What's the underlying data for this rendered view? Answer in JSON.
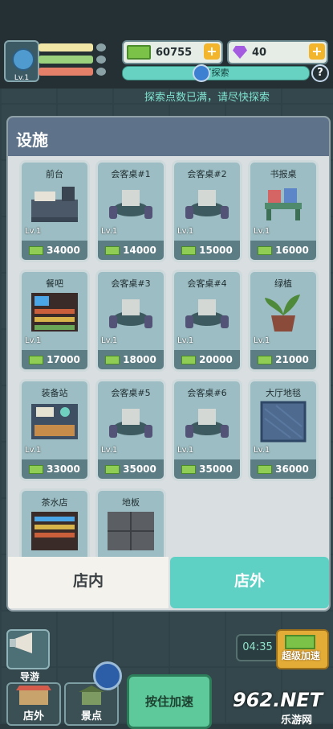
{
  "player": {
    "level": "Lv.1"
  },
  "currency": {
    "cash": "60755",
    "gems": "40"
  },
  "explore": {
    "label": "可探索",
    "notice": "探索点数已满，请尽快探索"
  },
  "panel": {
    "title": "设施",
    "items": [
      {
        "name": "前台",
        "level": "Lv.1",
        "price": "34000"
      },
      {
        "name": "会客桌#1",
        "level": "Lv.1",
        "price": "14000"
      },
      {
        "name": "会客桌#2",
        "level": "Lv.1",
        "price": "15000"
      },
      {
        "name": "书报桌",
        "level": "Lv.1",
        "price": "16000"
      },
      {
        "name": "餐吧",
        "level": "Lv.1",
        "price": "17000"
      },
      {
        "name": "会客桌#3",
        "level": "Lv.1",
        "price": "18000"
      },
      {
        "name": "会客桌#4",
        "level": "Lv.1",
        "price": "20000"
      },
      {
        "name": "绿植",
        "level": "Lv.1",
        "price": "21000"
      },
      {
        "name": "装备站",
        "level": "Lv.1",
        "price": "33000"
      },
      {
        "name": "会客桌#5",
        "level": "Lv.1",
        "price": "35000"
      },
      {
        "name": "会客桌#6",
        "level": "Lv.1",
        "price": "35000"
      },
      {
        "name": "大厅地毯",
        "level": "Lv.1",
        "price": "36000"
      },
      {
        "name": "茶水店"
      },
      {
        "name": "地板"
      }
    ],
    "tabs": {
      "inside": "店内",
      "outside": "店外"
    }
  },
  "bottom": {
    "guide": "导游",
    "timer": "04:35",
    "super_speed": "超级加速",
    "store_outside": "店外",
    "spot": "景点",
    "hold_speed": "按住加速"
  },
  "watermark": {
    "main": "962.NET",
    "sub": "乐游网"
  },
  "colors": {
    "accent": "#5ed0c4",
    "panel_header": "#5e7389",
    "price_bar": "#5d7d84"
  }
}
